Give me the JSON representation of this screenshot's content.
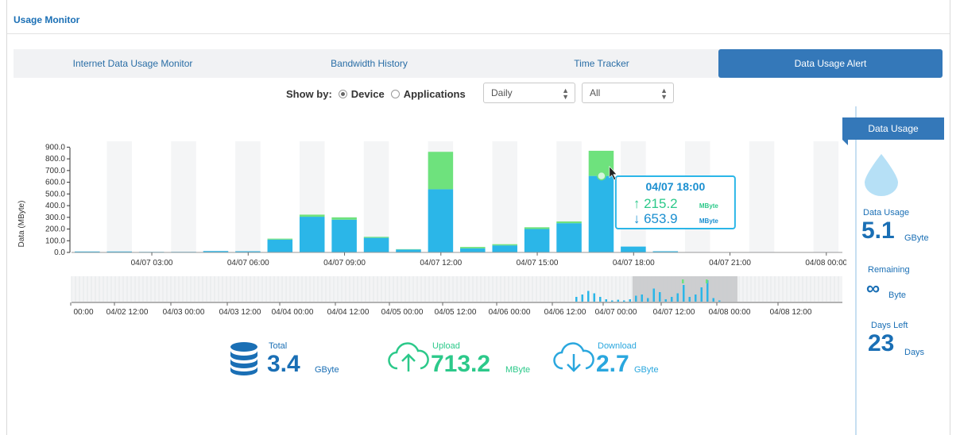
{
  "header": {
    "title": "Usage Monitor"
  },
  "tabs": [
    {
      "label": "Internet Data Usage Monitor",
      "active": false
    },
    {
      "label": "Bandwidth History",
      "active": false
    },
    {
      "label": "Time Tracker",
      "active": false
    },
    {
      "label": "Data Usage Alert",
      "active": true
    }
  ],
  "controls": {
    "show_by_label": "Show by:",
    "options": [
      {
        "label": "Device",
        "selected": true
      },
      {
        "label": "Applications",
        "selected": false
      }
    ],
    "period_select": "Daily",
    "filter_select": "All"
  },
  "chart_data": {
    "type": "bar",
    "stacked": true,
    "ylabel": "Data (MByte)",
    "ylim": [
      0,
      950
    ],
    "yticks": [
      "0.0",
      "100.0",
      "200.0",
      "300.0",
      "400.0",
      "500.0",
      "600.0",
      "700.0",
      "800.0",
      "900.0"
    ],
    "x_tick_labels": [
      "04/07 03:00",
      "04/07 06:00",
      "04/07 09:00",
      "04/07 12:00",
      "04/07 15:00",
      "04/07 18:00",
      "04/07 21:00",
      "04/08 00:00"
    ],
    "x_tick_index": [
      2,
      5,
      8,
      11,
      14,
      17,
      20,
      23
    ],
    "bar_count": 24,
    "series": [
      {
        "key": "download",
        "color": "#2bb6e8",
        "values": [
          8,
          8,
          5,
          5,
          12,
          10,
          110,
          305,
          280,
          125,
          25,
          540,
          35,
          60,
          200,
          250,
          654,
          50,
          10,
          0,
          0,
          0,
          0,
          0
        ]
      },
      {
        "key": "upload",
        "color": "#6ee27d",
        "values": [
          0,
          0,
          0,
          0,
          0,
          0,
          8,
          18,
          20,
          8,
          3,
          320,
          12,
          10,
          15,
          15,
          215,
          0,
          0,
          0,
          0,
          0,
          0,
          0
        ]
      }
    ],
    "tooltip": {
      "time": "04/07 18:00",
      "upload": "215.2",
      "download": "653.9",
      "unit": "MByte"
    },
    "overview": {
      "x_tick_labels": [
        "00:00",
        "04/02 12:00",
        "04/03 00:00",
        "04/03 12:00",
        "04/04 00:00",
        "04/04 12:00",
        "04/05 00:00",
        "04/05 12:00",
        "04/06 00:00",
        "04/06 12:00",
        "04/07 00:00",
        "04/07 12:00",
        "04/08 00:00",
        "04/08 12:00"
      ],
      "selection": [
        "04/07 00:00",
        "04/08 00:00"
      ],
      "values": [
        20,
        30,
        45,
        35,
        20,
        10,
        5,
        8,
        5,
        10,
        25,
        30,
        15,
        55,
        40,
        10,
        20,
        35,
        70,
        20,
        30,
        60,
        90,
        15,
        5
      ]
    }
  },
  "summary": {
    "total": {
      "label": "Total",
      "value": "3.4",
      "unit": "GByte"
    },
    "upload": {
      "label": "Upload",
      "value": "713.2",
      "unit": "MByte"
    },
    "download": {
      "label": "Download",
      "value": "2.7",
      "unit": "GByte"
    }
  },
  "sidebar": {
    "title": "Data Usage",
    "usage_label": "Data Usage",
    "usage_value": "5.1",
    "usage_unit": "GByte",
    "remaining_label": "Remaining",
    "remaining_value": "∞",
    "remaining_unit": "Byte",
    "days_label": "Days Left",
    "days_value": "23",
    "days_unit": "Days"
  },
  "colors": {
    "accent": "#3478b9",
    "download": "#2bb6e8",
    "upload": "#6ee27d",
    "total": "#1a6fb5"
  }
}
